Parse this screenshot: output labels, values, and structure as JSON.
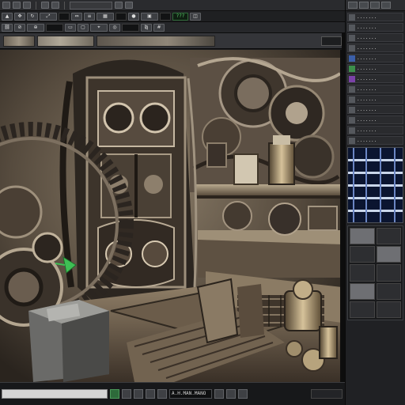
{
  "app": {
    "accent_green": "#3fbf55",
    "panel_bg": "#202124"
  },
  "menubar": {
    "icons": [
      "file-icon",
      "folder-icon",
      "save-icon",
      "undo-icon",
      "redo-icon",
      "render-icon"
    ]
  },
  "toolbar1": {
    "counter": "???"
  },
  "statusbar": {
    "field": "A.H.MAN.MANO"
  },
  "right_panel": {
    "rows": [
      {
        "icon": "layer-icon",
        "label": "......."
      },
      {
        "icon": "layer-icon",
        "label": "......."
      },
      {
        "icon": "layer-icon",
        "label": "......."
      },
      {
        "icon": "layer-icon",
        "label": "......."
      },
      {
        "icon": "light-icon",
        "label": "......."
      },
      {
        "icon": "camera-icon",
        "label": "......."
      },
      {
        "icon": "material-icon",
        "label": "......."
      },
      {
        "icon": "layer-icon",
        "label": "......."
      },
      {
        "icon": "layer-icon",
        "label": "......."
      },
      {
        "icon": "layer-icon",
        "label": "......."
      },
      {
        "icon": "layer-icon",
        "label": "......."
      },
      {
        "icon": "layer-icon",
        "label": "......."
      },
      {
        "icon": "layer-icon",
        "label": "......."
      }
    ]
  }
}
